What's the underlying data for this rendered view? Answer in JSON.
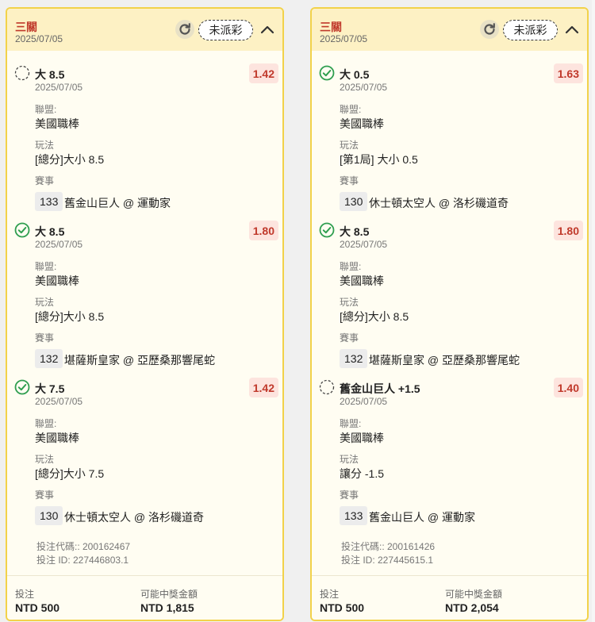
{
  "cards": [
    {
      "parlay_type": "三關",
      "date": "2025/07/05",
      "status_badge": "未派彩",
      "legs": [
        {
          "selection": "大 8.5",
          "odds": "1.42",
          "date": "2025/07/05",
          "league_label": "聯盟:",
          "league": "美國職棒",
          "market_label": "玩法",
          "market": "[總分]大小 8.5",
          "event_label": "賽事",
          "event_no": "133",
          "event": "舊金山巨人 @ 運動家",
          "result": "pending"
        },
        {
          "selection": "大 8.5",
          "odds": "1.80",
          "date": "2025/07/05",
          "league_label": "聯盟:",
          "league": "美國職棒",
          "market_label": "玩法",
          "market": "[總分]大小 8.5",
          "event_label": "賽事",
          "event_no": "132",
          "event": "堪薩斯皇家 @ 亞歷桑那響尾蛇",
          "result": "won"
        },
        {
          "selection": "大 7.5",
          "odds": "1.42",
          "date": "2025/07/05",
          "league_label": "聯盟:",
          "league": "美國職棒",
          "market_label": "玩法",
          "market": "[總分]大小 7.5",
          "event_label": "賽事",
          "event_no": "130",
          "event": "休士頓太空人 @ 洛杉磯道奇",
          "result": "won"
        }
      ],
      "bet_code": "投注代碼:: 200162467",
      "bet_id": "投注 ID: 227446803.1",
      "stake_label": "投注",
      "stake": "NTD 500",
      "payout_label": "可能中獎金額",
      "payout": "NTD 1,815"
    },
    {
      "parlay_type": "三關",
      "date": "2025/07/05",
      "status_badge": "未派彩",
      "legs": [
        {
          "selection": "大 0.5",
          "odds": "1.63",
          "date": "2025/07/05",
          "league_label": "聯盟:",
          "league": "美國職棒",
          "market_label": "玩法",
          "market": "[第1局] 大小 0.5",
          "event_label": "賽事",
          "event_no": "130",
          "event": "休士頓太空人 @ 洛杉磯道奇",
          "result": "won"
        },
        {
          "selection": "大 8.5",
          "odds": "1.80",
          "date": "2025/07/05",
          "league_label": "聯盟:",
          "league": "美國職棒",
          "market_label": "玩法",
          "market": "[總分]大小 8.5",
          "event_label": "賽事",
          "event_no": "132",
          "event": "堪薩斯皇家 @ 亞歷桑那響尾蛇",
          "result": "won"
        },
        {
          "selection": "舊金山巨人 +1.5",
          "odds": "1.40",
          "date": "2025/07/05",
          "league_label": "聯盟:",
          "league": "美國職棒",
          "market_label": "玩法",
          "market": "讓分 -1.5",
          "event_label": "賽事",
          "event_no": "133",
          "event": "舊金山巨人 @ 運動家",
          "result": "pending"
        }
      ],
      "bet_code": "投注代碼:: 200161426",
      "bet_id": "投注 ID: 227445615.1",
      "stake_label": "投注",
      "stake": "NTD 500",
      "payout_label": "可能中獎金額",
      "payout": "NTD 2,054"
    }
  ],
  "colors": {
    "accent": "#c0392b",
    "border": "#f2d24a",
    "header_bg": "#fdf1c4",
    "won": "#2e9e4f"
  },
  "icons": {
    "refresh": "refresh-icon",
    "collapse": "chevron-up-icon",
    "won": "check-circle-icon",
    "pending": "dashed-circle-icon"
  }
}
